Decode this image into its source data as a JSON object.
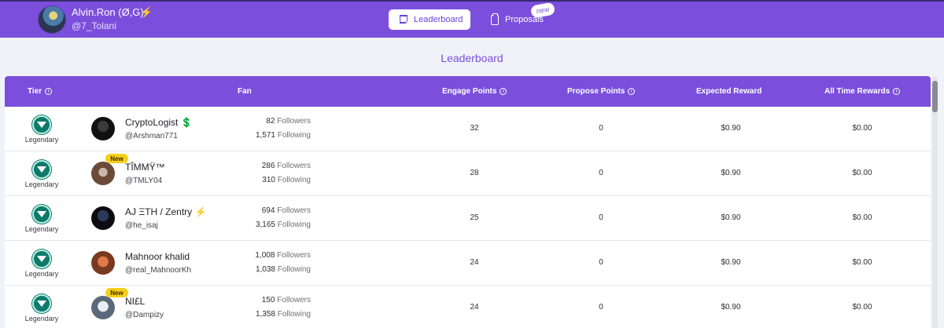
{
  "header": {
    "user_name": "Alvin.Ron (Ø,G)",
    "user_name_emoji": "⚡",
    "user_handle": "@7_Tolani",
    "nav": {
      "leaderboard_label": "Leaderboard",
      "proposals_label": "Proposals",
      "proposals_badge": "new"
    }
  },
  "page_title": "Leaderboard",
  "table": {
    "columns": [
      "Tier",
      "Fan",
      "Engage Points",
      "Propose Points",
      "Expected Reward",
      "All Time Rewards"
    ],
    "info_icon": "i",
    "followers_label": "Followers",
    "following_label": "Following",
    "rows": [
      {
        "tier": "Legendary",
        "name": "CryptoLogist 💲",
        "handle": "@Arshman771",
        "new": "",
        "followers": "82",
        "following": "1,571",
        "engage": "32",
        "propose": "0",
        "expected": "$0.90",
        "alltime": "$0.00"
      },
      {
        "tier": "Legendary",
        "name": "TÎMMŸ™",
        "handle": "@TMLY04",
        "new": "New",
        "followers": "286",
        "following": "310",
        "engage": "28",
        "propose": "0",
        "expected": "$0.90",
        "alltime": "$0.00"
      },
      {
        "tier": "Legendary",
        "name": "AJ ΞTH / Zentry ⚡",
        "handle": "@he_isaj",
        "new": "",
        "followers": "694",
        "following": "3,165",
        "engage": "25",
        "propose": "0",
        "expected": "$0.90",
        "alltime": "$0.00"
      },
      {
        "tier": "Legendary",
        "name": "Mahnoor khalid",
        "handle": "@real_MahnoorKh",
        "new": "",
        "followers": "1,008",
        "following": "1,038",
        "engage": "24",
        "propose": "0",
        "expected": "$0.90",
        "alltime": "$0.00"
      },
      {
        "tier": "Legendary",
        "name": "NI£L",
        "handle": "@Dampizy",
        "new": "New",
        "followers": "150",
        "following": "1,358",
        "engage": "24",
        "propose": "0",
        "expected": "$0.90",
        "alltime": "$0.00"
      }
    ]
  },
  "colors": {
    "brand": "#7b4fdc",
    "new_badge": "#f6cf1a",
    "tier_icon": "#0f7a6c"
  }
}
